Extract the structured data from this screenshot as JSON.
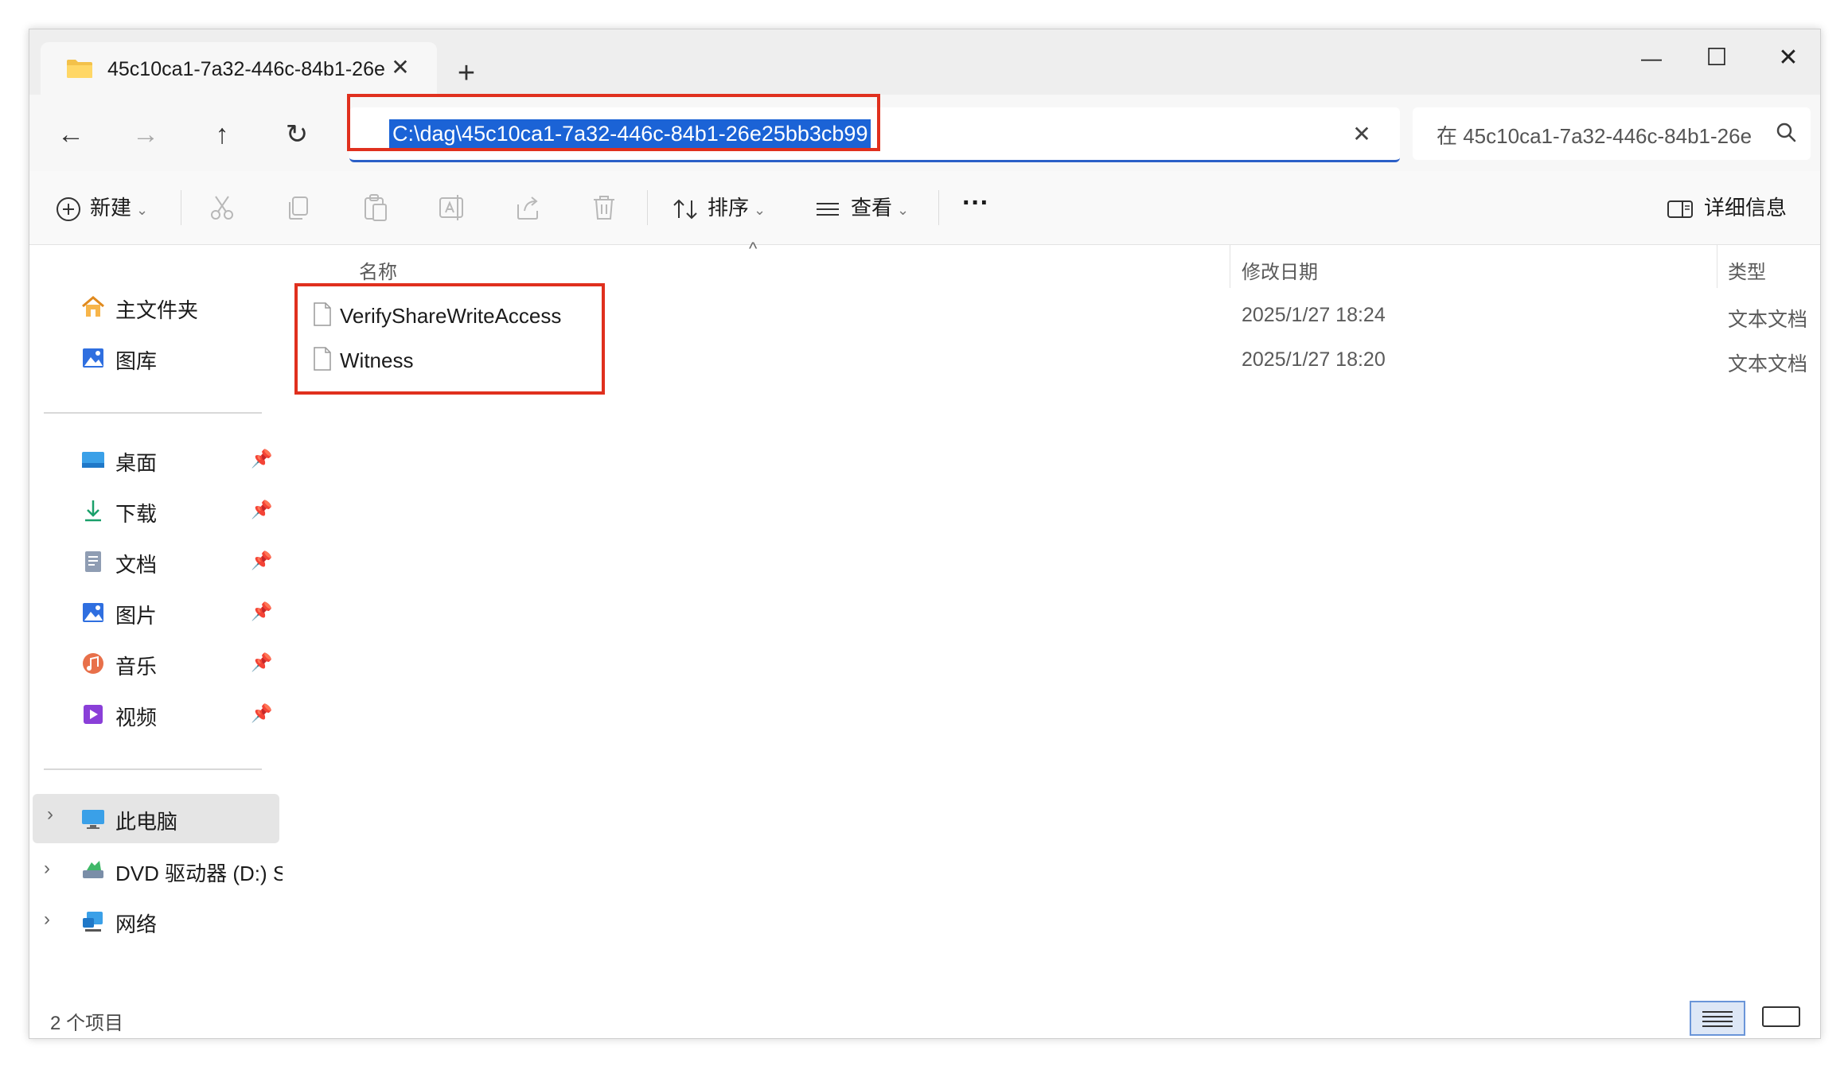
{
  "window": {
    "tab_title": "45c10ca1-7a32-446c-84b1-26e",
    "tab_close_glyph": "✕",
    "new_tab_glyph": "+",
    "minimize_glyph": "—",
    "maximize_glyph": "☐",
    "close_glyph": "✕"
  },
  "nav": {
    "back_glyph": "←",
    "forward_glyph": "→",
    "up_glyph": "↑",
    "refresh_glyph": "↻",
    "address_value": "C:\\dag\\45c10ca1-7a32-446c-84b1-26e25bb3cb99",
    "address_clear_glyph": "✕",
    "search_placeholder": "在 45c10ca1-7a32-446c-84b1-26e"
  },
  "toolbar": {
    "new_label": "新建",
    "sort_label": "排序",
    "view_label": "查看",
    "more_glyph": "···",
    "details_label": "详细信息",
    "chevron_glyph": "⌄"
  },
  "sidebar": {
    "quick": [
      {
        "label": "主文件夹",
        "icon": "home-icon"
      },
      {
        "label": "图库",
        "icon": "gallery-icon"
      }
    ],
    "pinned": [
      {
        "label": "桌面",
        "icon": "desktop-icon"
      },
      {
        "label": "下载",
        "icon": "download-icon"
      },
      {
        "label": "文档",
        "icon": "documents-icon"
      },
      {
        "label": "图片",
        "icon": "pictures-icon"
      },
      {
        "label": "音乐",
        "icon": "music-icon"
      },
      {
        "label": "视频",
        "icon": "video-icon"
      }
    ],
    "devices": [
      {
        "label": "此电脑",
        "icon": "this-pc-icon"
      },
      {
        "label": "DVD 驱动器 (D:) S",
        "icon": "dvd-drive-icon"
      },
      {
        "label": "网络",
        "icon": "network-icon"
      }
    ],
    "expander_glyph": "›"
  },
  "columns": {
    "name": "名称",
    "modified": "修改日期",
    "type": "类型",
    "sort_caret": "^"
  },
  "files": [
    {
      "name": "VerifyShareWriteAccess",
      "modified": "2025/1/27 18:24",
      "type": "文本文档"
    },
    {
      "name": "Witness",
      "modified": "2025/1/27 18:20",
      "type": "文本文档"
    }
  ],
  "status": {
    "item_count": "2 个项目"
  },
  "colors": {
    "accent": "#1b63d6",
    "highlight_box": "#e0301e"
  }
}
